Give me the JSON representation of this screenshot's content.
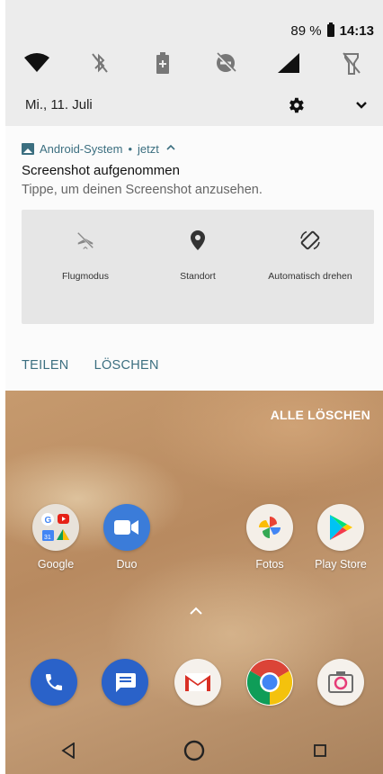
{
  "status_bar": {
    "battery_text": "89 %",
    "time": "14:13"
  },
  "quick_settings": {
    "tiles": [
      "wifi-icon",
      "bluetooth-off-icon",
      "battery-saver-icon",
      "do-not-disturb-icon",
      "mobile-signal-icon",
      "flashlight-off-icon"
    ],
    "date": "Mi., 11. Juli"
  },
  "notification": {
    "app_name": "Android-System",
    "separator": "•",
    "time": "jetzt",
    "title": "Screenshot aufgenommen",
    "body": "Tippe, um deinen Screenshot anzusehen.",
    "preview_tiles": [
      {
        "label": "Flugmodus",
        "icon": "airplane-off-icon"
      },
      {
        "label": "Standort",
        "icon": "location-icon"
      },
      {
        "label": "Automatisch drehen",
        "icon": "auto-rotate-icon"
      }
    ],
    "actions": {
      "share": "TEILEN",
      "delete": "LÖSCHEN"
    }
  },
  "home": {
    "clear_all": "ALLE LÖSCHEN",
    "apps_row1": [
      {
        "label": "Google",
        "icon": "google-folder-icon"
      },
      {
        "label": "Duo",
        "icon": "duo-icon"
      },
      {
        "label": "Fotos",
        "icon": "photos-icon"
      },
      {
        "label": "Play Store",
        "icon": "play-store-icon"
      }
    ],
    "dock": [
      "phone-icon",
      "messages-icon",
      "gmail-icon",
      "chrome-icon",
      "camera-icon"
    ]
  },
  "colors": {
    "accent": "#3c6f80",
    "shade_bg": "#ececec",
    "card_bg": "#fbfbfb",
    "wallpaper": "#b88a60"
  }
}
